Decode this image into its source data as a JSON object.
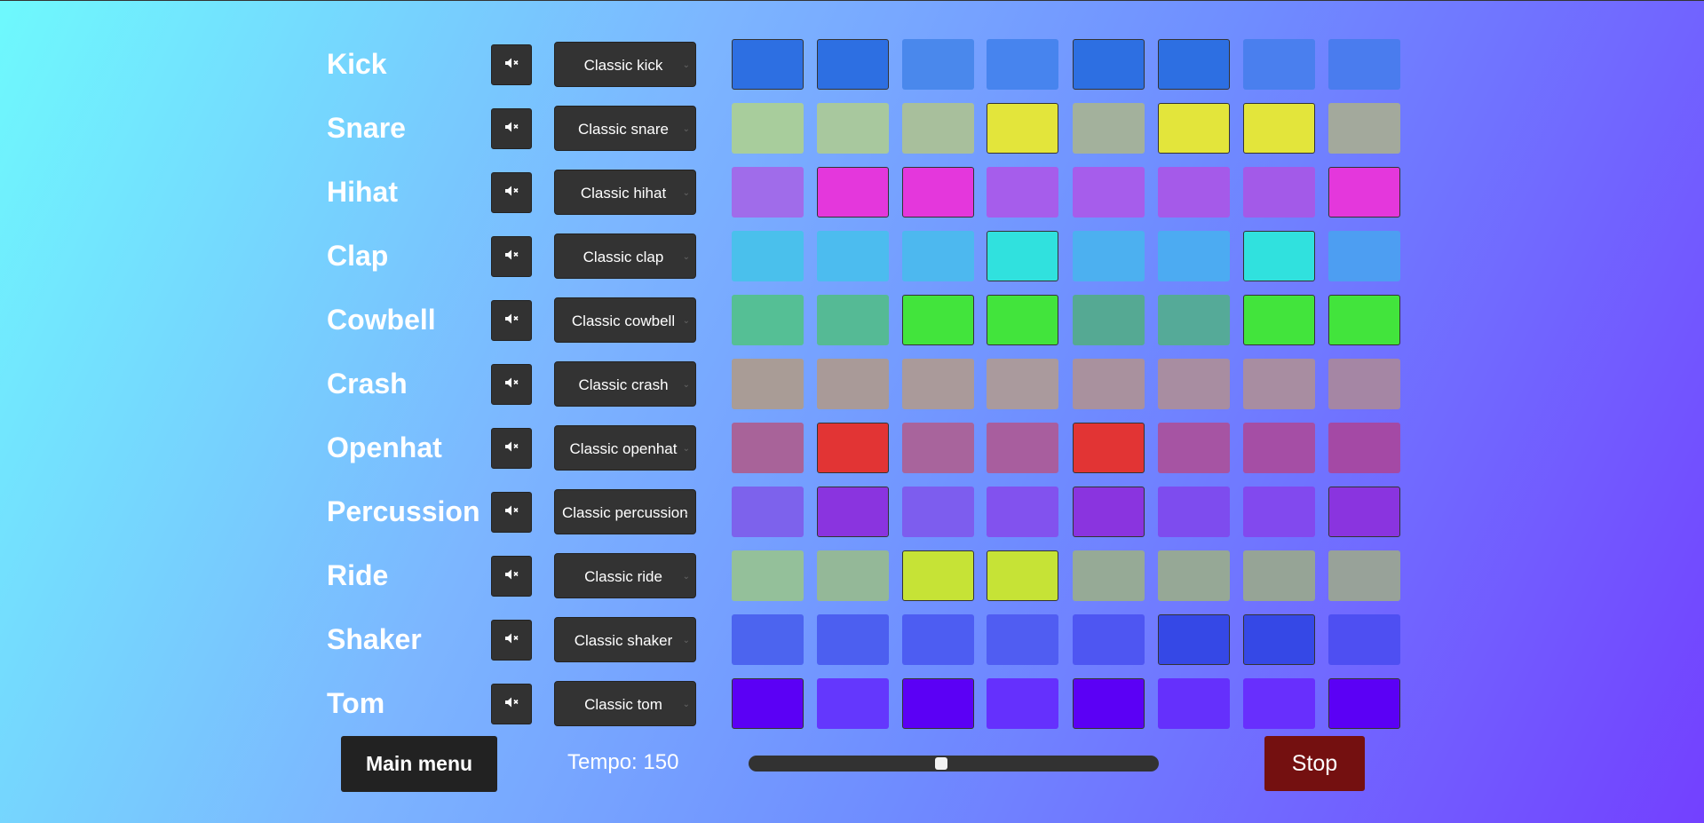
{
  "tracks": [
    {
      "name": "Kick",
      "sound": "Classic kick",
      "steps": [
        true,
        true,
        false,
        false,
        true,
        true,
        false,
        false
      ],
      "colors": [
        "#2d6fe2",
        "#2d6fe2",
        "#4a88ec",
        "#4784ee",
        "#2d6fe2",
        "#2d6fe2",
        "#4a7fee",
        "#4a7cee"
      ]
    },
    {
      "name": "Snare",
      "sound": "Classic snare",
      "steps": [
        false,
        false,
        false,
        true,
        false,
        true,
        true,
        false
      ],
      "colors": [
        "#a8cd9c",
        "#a8c89e",
        "#a8bf9c",
        "#e3e53b",
        "#a3b19c",
        "#e3e53b",
        "#e3e53b",
        "#a3a99c"
      ]
    },
    {
      "name": "Hihat",
      "sound": "Classic hihat",
      "steps": [
        false,
        true,
        true,
        false,
        false,
        false,
        false,
        true
      ],
      "colors": [
        "#a06cea",
        "#e437dc",
        "#e437dc",
        "#a65deb",
        "#a65deb",
        "#a55ae9",
        "#a35ae8",
        "#e437dc"
      ]
    },
    {
      "name": "Clap",
      "sound": "Classic clap",
      "steps": [
        false,
        false,
        false,
        true,
        false,
        false,
        true,
        false
      ],
      "colors": [
        "#4ac0ec",
        "#4cbcef",
        "#4db8ef",
        "#30e1de",
        "#4cb0f0",
        "#4cabf2",
        "#30e1de",
        "#4d9ef2"
      ]
    },
    {
      "name": "Cowbell",
      "sound": "Classic cowbell",
      "steps": [
        false,
        false,
        true,
        true,
        false,
        false,
        true,
        true
      ],
      "colors": [
        "#55bf95",
        "#55ba95",
        "#42e43c",
        "#42e43c",
        "#55a993",
        "#55aa98",
        "#42e43c",
        "#42e43c"
      ]
    },
    {
      "name": "Crash",
      "sound": "Classic crash",
      "steps": [
        false,
        false,
        false,
        false,
        false,
        false,
        false,
        false
      ],
      "colors": [
        "#a99c96",
        "#a99a98",
        "#aa9a9a",
        "#aa9a9d",
        "#a9919e",
        "#a88da1",
        "#a88da1",
        "#a586a4"
      ]
    },
    {
      "name": "Openhat",
      "sound": "Classic openhat",
      "steps": [
        false,
        true,
        false,
        false,
        true,
        false,
        false,
        false
      ],
      "colors": [
        "#a86399",
        "#e23434",
        "#a8649c",
        "#a85e9e",
        "#e23434",
        "#a654a3",
        "#a54ea5",
        "#a449a5"
      ]
    },
    {
      "name": "Percussion",
      "sound": "Classic percussion",
      "steps": [
        false,
        true,
        false,
        false,
        true,
        false,
        false,
        true
      ],
      "colors": [
        "#7d62ec",
        "#8a34df",
        "#7d5dee",
        "#8252ee",
        "#8a34df",
        "#7e4cee",
        "#8249ee",
        "#8a34df"
      ]
    },
    {
      "name": "Ride",
      "sound": "Classic ride",
      "steps": [
        false,
        false,
        true,
        true,
        false,
        false,
        false,
        false
      ],
      "colors": [
        "#94c09a",
        "#94b898",
        "#c6e336",
        "#c6e336",
        "#96aa96",
        "#96a896",
        "#96a496",
        "#98a299"
      ]
    },
    {
      "name": "Shaker",
      "sound": "Classic shaker",
      "steps": [
        false,
        false,
        false,
        false,
        false,
        true,
        true,
        false
      ],
      "colors": [
        "#4c64ef",
        "#4c5ff0",
        "#4d5df2",
        "#505df2",
        "#4e56f2",
        "#3548e6",
        "#3548e6",
        "#4e4ff2"
      ]
    },
    {
      "name": "Tom",
      "sound": "Classic tom",
      "steps": [
        true,
        false,
        true,
        false,
        true,
        false,
        false,
        true
      ],
      "colors": [
        "#5b00f5",
        "#6437fd",
        "#5b00f5",
        "#6530fd",
        "#5b00f5",
        "#6530fc",
        "#682ffd",
        "#5b00f5"
      ]
    }
  ],
  "controls": {
    "main_menu_label": "Main menu",
    "tempo_label": "Tempo: 150",
    "tempo_value": 150,
    "tempo_slider_fraction": 0.47,
    "stop_label": "Stop"
  },
  "icons": {
    "mute": "speaker-muted-icon",
    "dropdown": "chevron-down-icon"
  }
}
